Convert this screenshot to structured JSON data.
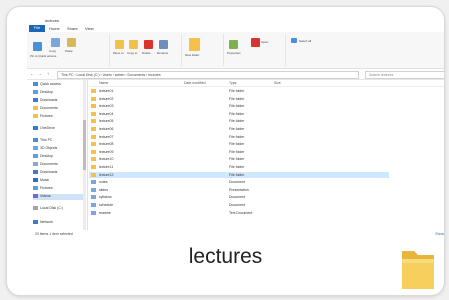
{
  "window": {
    "title": "lectures",
    "tabs": [
      "File",
      "Home",
      "Share",
      "View"
    ]
  },
  "ribbon": {
    "labels": [
      "Pin to Quick access",
      "Copy",
      "Paste",
      "Move to",
      "Copy to",
      "Delete",
      "Rename",
      "New folder",
      "Properties",
      "Open",
      "Select all"
    ]
  },
  "address": {
    "path": "This PC › Local Disk (C:) › Users › admin › Documents › lectures",
    "search_placeholder": "Search lectures"
  },
  "nav": {
    "items": [
      "Quick access",
      "Desktop",
      "Downloads",
      "Documents",
      "Pictures",
      "OneDrive",
      "This PC",
      "3D Objects",
      "Desktop",
      "Documents",
      "Downloads",
      "Music",
      "Pictures",
      "Videos",
      "Local Disk (C:)",
      "Network"
    ]
  },
  "files": {
    "headers": [
      "Name",
      "Date modified",
      "Type",
      "Size"
    ],
    "rows": [
      {
        "name": "lecture01",
        "date": "",
        "type": "File folder",
        "size": ""
      },
      {
        "name": "lecture02",
        "date": "",
        "type": "File folder",
        "size": ""
      },
      {
        "name": "lecture03",
        "date": "",
        "type": "File folder",
        "size": ""
      },
      {
        "name": "lecture04",
        "date": "",
        "type": "File folder",
        "size": ""
      },
      {
        "name": "lecture05",
        "date": "",
        "type": "File folder",
        "size": ""
      },
      {
        "name": "lecture06",
        "date": "",
        "type": "File folder",
        "size": ""
      },
      {
        "name": "lecture07",
        "date": "",
        "type": "File folder",
        "size": ""
      },
      {
        "name": "lecture08",
        "date": "",
        "type": "File folder",
        "size": ""
      },
      {
        "name": "lecture09",
        "date": "",
        "type": "File folder",
        "size": ""
      },
      {
        "name": "lecture10",
        "date": "",
        "type": "File folder",
        "size": ""
      },
      {
        "name": "lecture11",
        "date": "",
        "type": "File folder",
        "size": ""
      },
      {
        "name": "lecture12",
        "date": "",
        "type": "File folder",
        "size": ""
      },
      {
        "name": "notes",
        "date": "",
        "type": "Document",
        "size": ""
      },
      {
        "name": "slides",
        "date": "",
        "type": "Presentation",
        "size": ""
      },
      {
        "name": "syllabus",
        "date": "",
        "type": "Document",
        "size": ""
      },
      {
        "name": "schedule",
        "date": "",
        "type": "Document",
        "size": ""
      },
      {
        "name": "readme",
        "date": "",
        "type": "Text Document",
        "size": ""
      }
    ]
  },
  "status": {
    "left": "20 items   1 item selected",
    "right": "Show"
  },
  "caption": "lectures",
  "colors": {
    "accent": "#1a66b8",
    "folder": "#f4c24c",
    "selection": "#cde8ff"
  }
}
